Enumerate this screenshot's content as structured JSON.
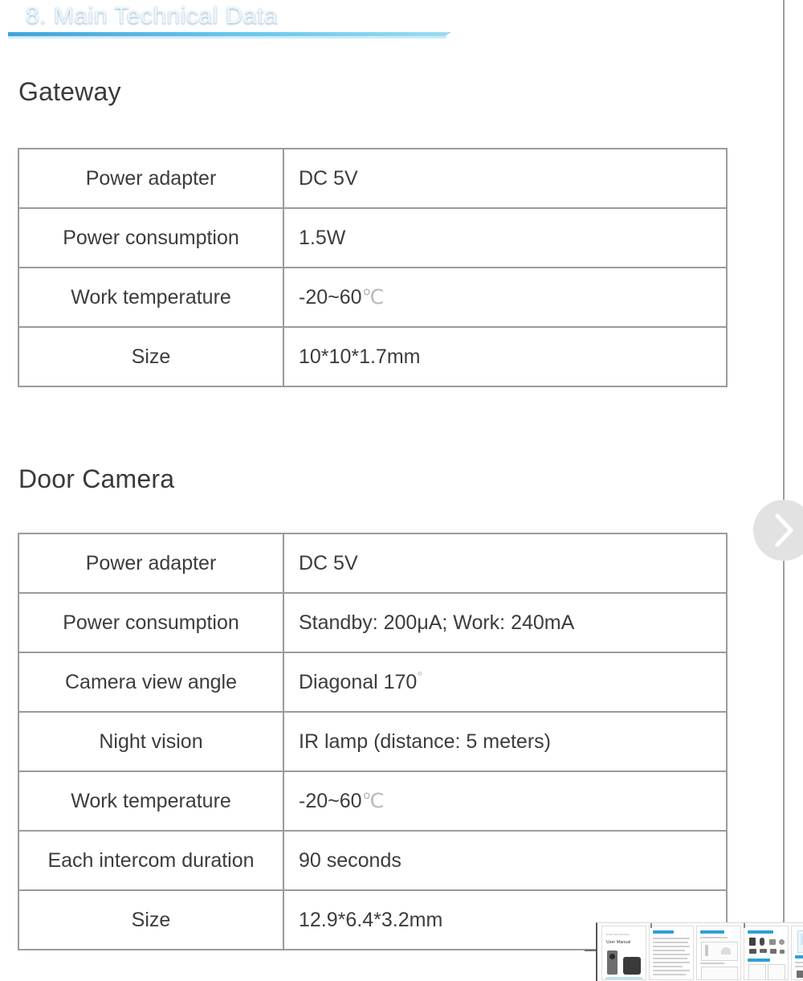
{
  "banner": {
    "title": "8. Main Technical Data",
    "accent_color": "#2f9fd6"
  },
  "sections": [
    {
      "heading": "Gateway",
      "table_name": "gateway-spec-table",
      "rows": [
        {
          "label": "Power adapter",
          "value": "DC 5V"
        },
        {
          "label": "Power consumption",
          "value": "1.5W"
        },
        {
          "label": "Work temperature",
          "value": "-20~60℃"
        },
        {
          "label": "Size",
          "value": "10*10*1.7mm"
        }
      ]
    },
    {
      "heading": "Door Camera",
      "table_name": "door-camera-spec-table",
      "rows": [
        {
          "label": "Power adapter",
          "value": "DC 5V"
        },
        {
          "label": "Power consumption",
          "value": "Standby: 200μA; Work: 240mA"
        },
        {
          "label": "Camera view angle",
          "value": "Diagonal 170°"
        },
        {
          "label": "Night vision",
          "value": "IR lamp (distance: 5 meters)"
        },
        {
          "label": "Work temperature",
          "value": "-20~60℃"
        },
        {
          "label": "Each intercom duration",
          "value": "90 seconds"
        },
        {
          "label": "Size",
          "value": "12.9*6.4*3.2mm"
        }
      ]
    }
  ],
  "controls": {
    "next_icon": "chevron-right-icon",
    "next_label": "Next image"
  },
  "thumbnails": {
    "cover_title": "User Manual",
    "cover_sub": "Smart Video Doorbell",
    "count": 5
  }
}
